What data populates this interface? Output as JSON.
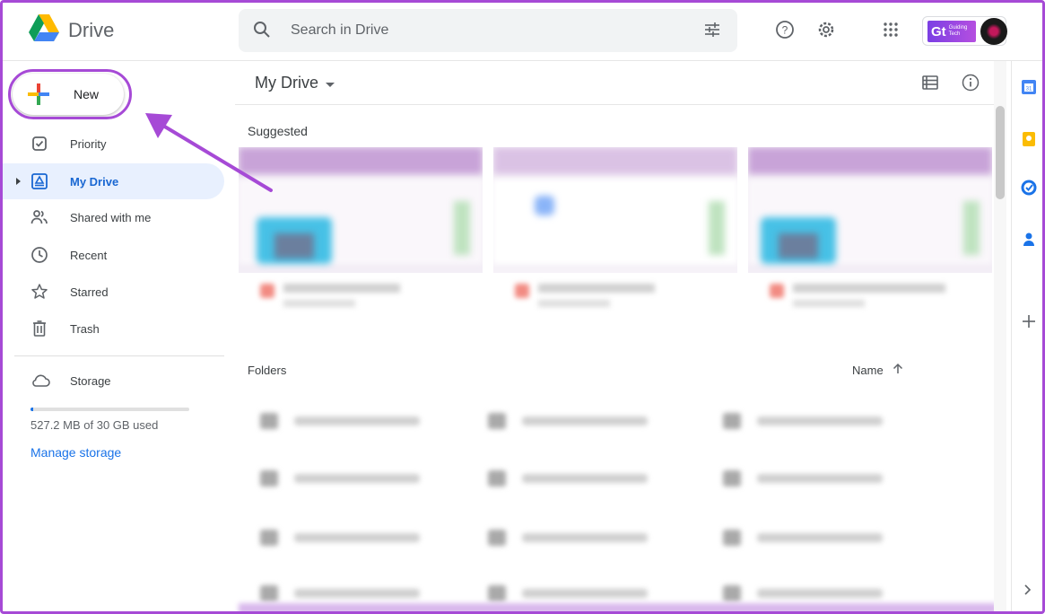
{
  "app": {
    "name": "Drive"
  },
  "search": {
    "placeholder": "Search in Drive"
  },
  "header": {
    "icons": [
      "search-icon",
      "tune-icon",
      "help-icon",
      "settings-icon",
      "apps-icon"
    ],
    "badge": {
      "letters": "Gt",
      "line1": "Guiding",
      "line2": "Tech"
    }
  },
  "sidebar": {
    "new_label": "New",
    "items": [
      {
        "label": "Priority",
        "icon": "priority-icon"
      },
      {
        "label": "My Drive",
        "icon": "my-drive-icon",
        "active": true
      },
      {
        "label": "Shared with me",
        "icon": "shared-icon"
      },
      {
        "label": "Recent",
        "icon": "clock-icon"
      },
      {
        "label": "Starred",
        "icon": "star-icon"
      },
      {
        "label": "Trash",
        "icon": "trash-icon"
      }
    ],
    "storage": {
      "label": "Storage",
      "used_text": "527.2 MB of 30 GB used",
      "used_fraction": 0.017,
      "manage_label": "Manage storage"
    }
  },
  "main": {
    "title": "My Drive",
    "suggested_label": "Suggested",
    "folders_label": "Folders",
    "sort_label": "Name"
  },
  "colors": {
    "accent": "#1a73e8",
    "annotation": "#a64ad6",
    "active_bg": "#e8f0fe"
  },
  "rail": {
    "icons": [
      "calendar-icon",
      "keep-icon",
      "tasks-icon",
      "contacts-icon",
      "add-icon",
      "chevron-right-icon"
    ]
  }
}
